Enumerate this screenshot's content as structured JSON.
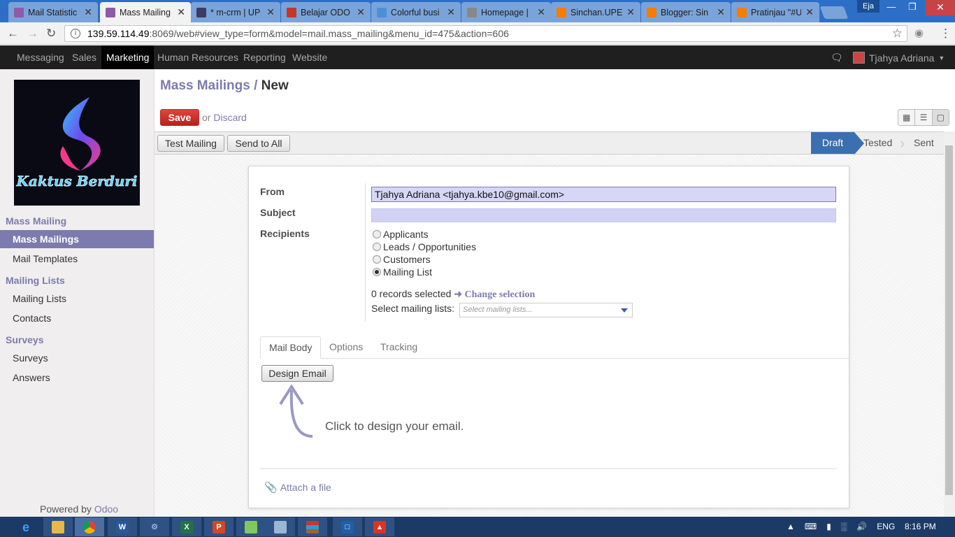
{
  "browser": {
    "tabs": [
      {
        "title": "Mail Statistic",
        "active": false,
        "icon": "odoo-icon",
        "color": "#8e5aa8"
      },
      {
        "title": "Mass Mailing",
        "active": true,
        "icon": "odoo-icon",
        "color": "#8e5aa8"
      },
      {
        "title": "* m-crm | UP",
        "active": false,
        "icon": "slack-icon",
        "color": "#3b3b66"
      },
      {
        "title": "Belajar ODO",
        "active": false,
        "icon": "odoo-icon",
        "color": "#c0392b"
      },
      {
        "title": "Colorful busi",
        "active": false,
        "icon": "image-icon",
        "color": "#4a90d9"
      },
      {
        "title": "Homepage |",
        "active": false,
        "icon": "page-icon",
        "color": "#888888"
      },
      {
        "title": "Sinchan.UPE",
        "active": false,
        "icon": "blogger-icon",
        "color": "#f57d00"
      },
      {
        "title": "Blogger: Sin",
        "active": false,
        "icon": "blogger-icon",
        "color": "#f57d00"
      },
      {
        "title": "Pratinjau \"#U",
        "active": false,
        "icon": "blogger-icon",
        "color": "#f57d00"
      }
    ],
    "profile_name": "Eja",
    "url_host": "139.59.114.49",
    "url_rest": ":8069/web#view_type=form&model=mail.mass_mailing&menu_id=475&action=606"
  },
  "topnav": {
    "items": [
      "Messaging",
      "Sales",
      "Marketing",
      "Human Resources",
      "Reporting",
      "Website"
    ],
    "active": "Marketing",
    "user": "Tjahya Adriana"
  },
  "logo": {
    "text": "Kaktus Berduri"
  },
  "sidebar": {
    "sections": [
      {
        "title": "Mass Mailing",
        "items": [
          "Mass Mailings",
          "Mail Templates"
        ]
      },
      {
        "title": "Mailing Lists",
        "items": [
          "Mailing Lists",
          "Contacts"
        ]
      },
      {
        "title": "Surveys",
        "items": [
          "Surveys",
          "Answers"
        ]
      }
    ],
    "active_item": "Mass Mailings",
    "powered_prefix": "Powered by",
    "powered_brand": "Odoo"
  },
  "header": {
    "breadcrumb_parent": "Mass Mailings",
    "breadcrumb_sep": "/",
    "breadcrumb_current": "New",
    "save": "Save",
    "or": "or",
    "discard": "Discard"
  },
  "statusbar": {
    "buttons": [
      "Test Mailing",
      "Send to All"
    ],
    "stages": [
      "Draft",
      "Tested",
      "Sent"
    ],
    "current_stage": "Draft"
  },
  "form": {
    "from_label": "From",
    "from_value": "Tjahya Adriana <tjahya.kbe10@gmail.com>",
    "subject_label": "Subject",
    "subject_value": "",
    "recipients_label": "Recipients",
    "recipient_options": [
      "Applicants",
      "Leads / Opportunities",
      "Customers",
      "Mailing List"
    ],
    "recipient_selected": "Mailing List",
    "records_text": "0 records selected",
    "change_selection": "Change selection",
    "select_lists_label": "Select mailing lists:",
    "select_lists_placeholder": "Select mailing lists..."
  },
  "tabs": {
    "items": [
      "Mail Body",
      "Options",
      "Tracking"
    ],
    "active": "Mail Body"
  },
  "mail_body": {
    "design_button": "Design Email",
    "hint": "Click to design your email."
  },
  "attach": "Attach a file",
  "taskbar": {
    "apps": [
      "ie-icon",
      "explorer-icon",
      "chrome-icon",
      "word-icon",
      "tool-icon",
      "excel-icon",
      "powerpoint-icon",
      "chat-icon",
      "window-icon",
      "winrar-icon",
      "app-icon",
      "pdf-icon"
    ],
    "language": "ENG",
    "time": "8:16 PM"
  }
}
